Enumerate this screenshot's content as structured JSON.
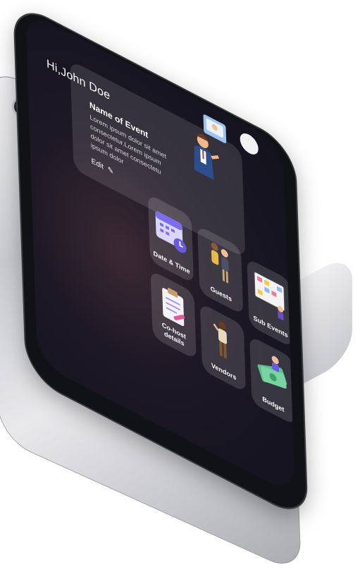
{
  "header": {
    "greeting": "Hi,John Doe",
    "profile_icon": "avatar-circle"
  },
  "event_card": {
    "title": "Name of Event",
    "description": "Lorem ipsum dolor sit amet consectetur.Lorem ipsum dolor sit amet consectetu ipsum dolor",
    "edit_label": "Edit",
    "edit_icon": "pencil-icon"
  },
  "tiles": [
    {
      "label": "Date & Time",
      "icon": "calendar-clock-icon"
    },
    {
      "label": "Guests",
      "icon": "people-icon"
    },
    {
      "label": "Sub Events",
      "icon": "board-icon"
    },
    {
      "label": "Co-host details",
      "icon": "clipboard-icon"
    },
    {
      "label": "Vendors",
      "icon": "person-icon"
    },
    {
      "label": "Budget",
      "icon": "money-icon"
    }
  ],
  "colors": {
    "screen_bg": "#1d1826",
    "card_bg": "rgba(255,255,255,0.12)",
    "text": "#ffffff",
    "calendar_accent": "#7b6cf0"
  }
}
